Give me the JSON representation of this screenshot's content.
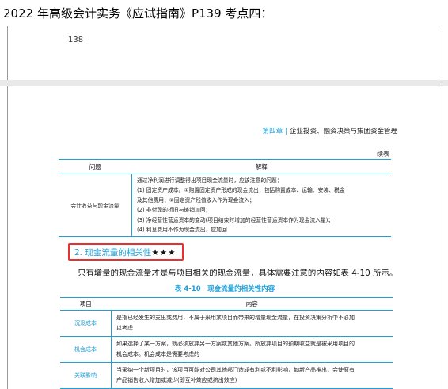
{
  "caption": "2022 年高级会计实务《应试指南》P139 考点四：",
  "page_top": {
    "page_number": "138"
  },
  "header": {
    "chapter_num": "第四章",
    "chapter_sep": "|",
    "chapter_title": "企业投资、融资决策与集团资金管理"
  },
  "continued_label": "续表",
  "table1": {
    "headers": [
      "问题",
      "解释"
    ],
    "row": {
      "issue": "会计收益与现金流量",
      "lines": [
        "通过净利润进行调整得出项目现金流量时，应该注意的问题：",
        "(1) 固定资产成本。①购置固定资产形成的现金流出，包括购置成本、运输、安装、税金",
        "及其他费用；②固定资产残值收入作为现金流入；",
        "(2) 非付现的折旧与摊销加回；",
        "(3) 净经营性营运资本的变动(项目结束时增加的经营性营运资本作为现金流入量)；",
        "(4) 利息费用不作为现金流出，应加回"
      ]
    }
  },
  "section": {
    "title": "2. 现金流量的相关性",
    "stars": "★★★"
  },
  "paragraph": "只有增量的现金流量才是与项目相关的现金流量，具体需要注意的内容如表 4-10 所示。",
  "table2": {
    "caption": "表 4-10　现金流量的相关性内容",
    "headers": [
      "项目",
      "内容"
    ],
    "rows": [
      {
        "item": "沉没成本",
        "lines": [
          "是指已经发生的支出或费用，不属于采用某项目而带来的增量现金流量，在投资决策分析中不必加",
          "以考虑"
        ]
      },
      {
        "item": "机会成本",
        "lines": [
          "如果选择了某一方案，就必须放弃另一方案或其他方案。所放弃项目的预期收益就是被采用项目的",
          "机会成本。机会成本是需要考虑的"
        ]
      },
      {
        "item": "关联影响",
        "lines": [
          "当采纳一个新项目时，该项目可能对公司其他部门造成有利或不利影响，如新产品推出，会使原有",
          "产品销售收入增加或减少(即互补效应或挤出效应)"
        ]
      }
    ]
  }
}
